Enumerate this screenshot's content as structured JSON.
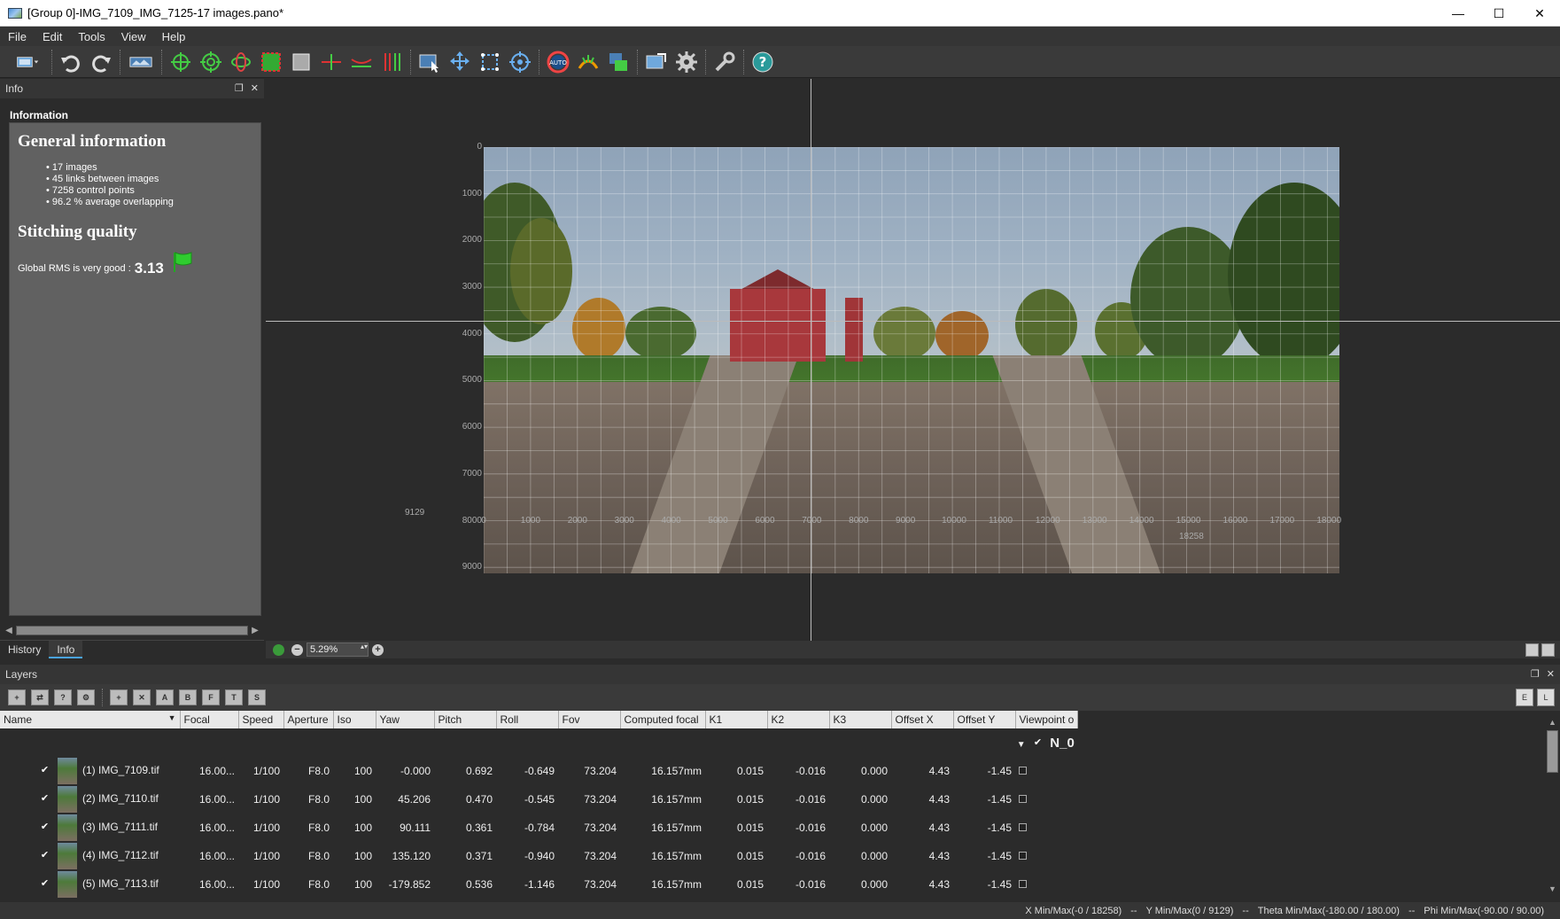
{
  "window": {
    "title": "[Group 0]-IMG_7109_IMG_7125-17 images.pano*",
    "minimize": "—",
    "maximize": "☐",
    "close": "✕"
  },
  "menu": [
    "File",
    "Edit",
    "Tools",
    "View",
    "Help"
  ],
  "toolbar_icons": [
    "project-icon",
    "undo-icon",
    "redo-icon",
    "panorama-icon",
    "cp-add-icon",
    "cp-ring-icon",
    "cp-orbit-icon",
    "crop-icon",
    "mask-icon",
    "line-icon",
    "horizon-icon",
    "vertical-lines-icon",
    "select-icon",
    "move-icon",
    "transform-icon",
    "target-icon",
    "auto-color-icon",
    "levels-icon",
    "layers-icon",
    "export-icon",
    "settings-icon",
    "tools-icon",
    "help-icon"
  ],
  "info_panel": {
    "header": "Info",
    "section": "Information",
    "general_title": "General information",
    "stats": [
      "17 images",
      "45 links between images",
      "7258 control points",
      "96.2 % average overlapping"
    ],
    "quality_title": "Stitching quality",
    "rms_label": "Global RMS is very good :",
    "rms_value": "3.13"
  },
  "panel_tabs": [
    "History",
    "Info"
  ],
  "active_tab": "Info",
  "canvas": {
    "x_ticks": [
      "0",
      "1000",
      "2000",
      "3000",
      "4000",
      "5000",
      "6000",
      "7000",
      "8000",
      "9000",
      "10000",
      "11000",
      "12000",
      "13000",
      "14000",
      "15000",
      "16000",
      "17000",
      "18000"
    ],
    "y_ticks": [
      "0",
      "1000",
      "2000",
      "3000",
      "4000",
      "5000",
      "6000",
      "7000",
      "8000",
      "9000"
    ],
    "y_max_label": "9129",
    "x_max_label": "18258"
  },
  "zoom": {
    "value": "5.29%"
  },
  "layers": {
    "header": "Layers",
    "columns": [
      "Name",
      "Focal",
      "Speed",
      "Aperture",
      "Iso",
      "Yaw",
      "Pitch",
      "Roll",
      "Fov",
      "Computed focal",
      "K1",
      "K2",
      "K3",
      "Offset X",
      "Offset Y",
      "Viewpoint o"
    ],
    "group_name": "N_0",
    "rows": [
      [
        "(1) IMG_7109.tif",
        "16.00...",
        "1/100",
        "F8.0",
        "100",
        "-0.000",
        "0.692",
        "-0.649",
        "73.204",
        "16.157mm",
        "0.015",
        "-0.016",
        "0.000",
        "4.43",
        "-1.45"
      ],
      [
        "(2) IMG_7110.tif",
        "16.00...",
        "1/100",
        "F8.0",
        "100",
        "45.206",
        "0.470",
        "-0.545",
        "73.204",
        "16.157mm",
        "0.015",
        "-0.016",
        "0.000",
        "4.43",
        "-1.45"
      ],
      [
        "(3) IMG_7111.tif",
        "16.00...",
        "1/100",
        "F8.0",
        "100",
        "90.111",
        "0.361",
        "-0.784",
        "73.204",
        "16.157mm",
        "0.015",
        "-0.016",
        "0.000",
        "4.43",
        "-1.45"
      ],
      [
        "(4) IMG_7112.tif",
        "16.00...",
        "1/100",
        "F8.0",
        "100",
        "135.120",
        "0.371",
        "-0.940",
        "73.204",
        "16.157mm",
        "0.015",
        "-0.016",
        "0.000",
        "4.43",
        "-1.45"
      ],
      [
        "(5) IMG_7113.tif",
        "16.00...",
        "1/100",
        "F8.0",
        "100",
        "-179.852",
        "0.536",
        "-1.146",
        "73.204",
        "16.157mm",
        "0.015",
        "-0.016",
        "0.000",
        "4.43",
        "-1.45"
      ]
    ]
  },
  "status": {
    "x": "X Min/Max(-0 / 18258)",
    "y": "Y Min/Max(0 / 9129)",
    "theta": "Theta Min/Max(-180.00 / 180.00)",
    "phi": "Phi Min/Max(-90.00 / 90.00)",
    "sep": "--"
  },
  "colors": {
    "accent": "#4aa3df",
    "flag": "#2fcc2f",
    "panel_bg": "#616161"
  }
}
